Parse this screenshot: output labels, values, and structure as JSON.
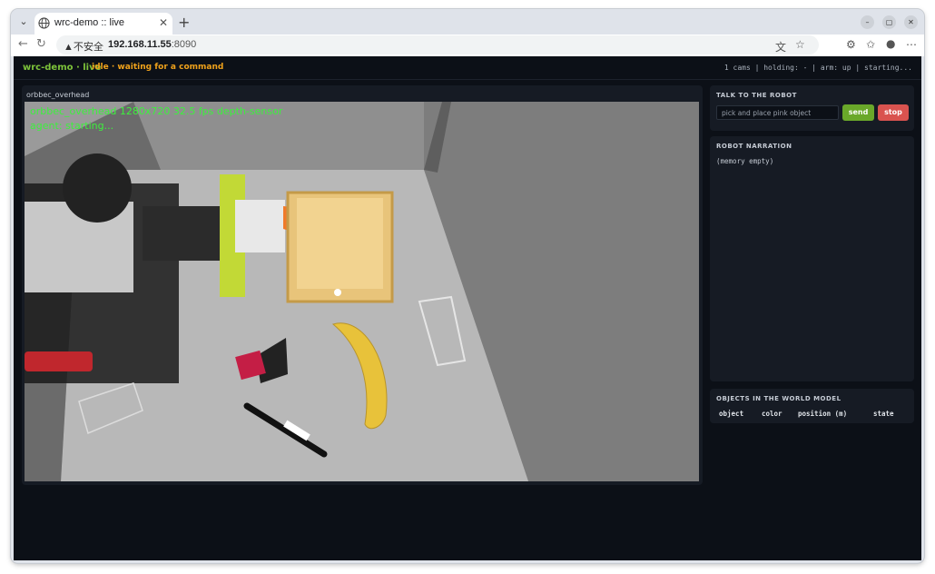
{
  "browser": {
    "tab_title": "wrc-demo :: live",
    "security_label": "▲不安全",
    "url_host": "192.168.11.55",
    "url_port": ":8090"
  },
  "app": {
    "brand": "wrc-demo · live",
    "status": "idle · waiting for a command",
    "stats": "1 cams | holding: - | arm: up | starting...",
    "status_color": "#f0a21b",
    "brand_color": "#7dc33a"
  },
  "camera": {
    "label": "orbbec_overhead",
    "overlay_line1": "orbbec_overhead 1280x720 32.5 fps depth-sensor",
    "overlay_line2": "agent: starting..."
  },
  "talk": {
    "title": "TALK TO THE ROBOT",
    "placeholder": "pick and place pink object",
    "send_label": "send",
    "stop_label": "stop",
    "send_color": "#6aa82a",
    "stop_color": "#d9534f"
  },
  "narration": {
    "title": "ROBOT NARRATION",
    "text": "(memory empty)"
  },
  "world_model": {
    "title": "OBJECTS IN THE WORLD MODEL",
    "columns": [
      "object",
      "color",
      "position (m)",
      "state"
    ]
  }
}
